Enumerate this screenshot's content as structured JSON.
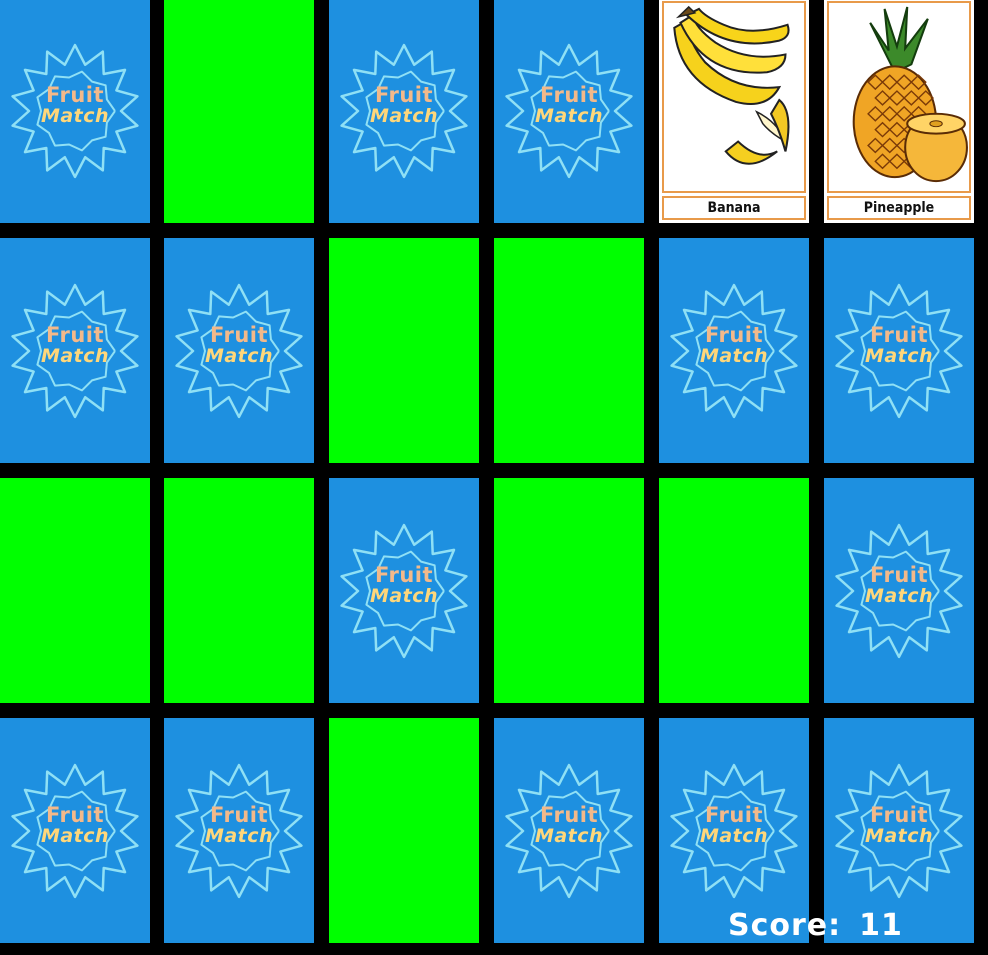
{
  "game": {
    "logo_line1": "Fruit",
    "logo_line2": "Match",
    "score_label": "Score:",
    "score_value": "11",
    "colors": {
      "card_back": "#1e90e0",
      "matched": "#00ff00",
      "background": "#000000",
      "logo_outline": "#8fe0f5"
    },
    "grid": [
      [
        "back",
        "matched",
        "back",
        "back",
        "face:Banana",
        "face:Pineapple"
      ],
      [
        "back",
        "back",
        "matched",
        "matched",
        "back",
        "back"
      ],
      [
        "matched",
        "matched",
        "back",
        "matched",
        "matched",
        "back"
      ],
      [
        "back",
        "back",
        "matched",
        "back",
        "back",
        "back"
      ]
    ],
    "faces": {
      "Banana": {
        "label": "Banana",
        "icon": "banana-icon"
      },
      "Pineapple": {
        "label": "Pineapple",
        "icon": "pineapple-icon"
      }
    }
  }
}
